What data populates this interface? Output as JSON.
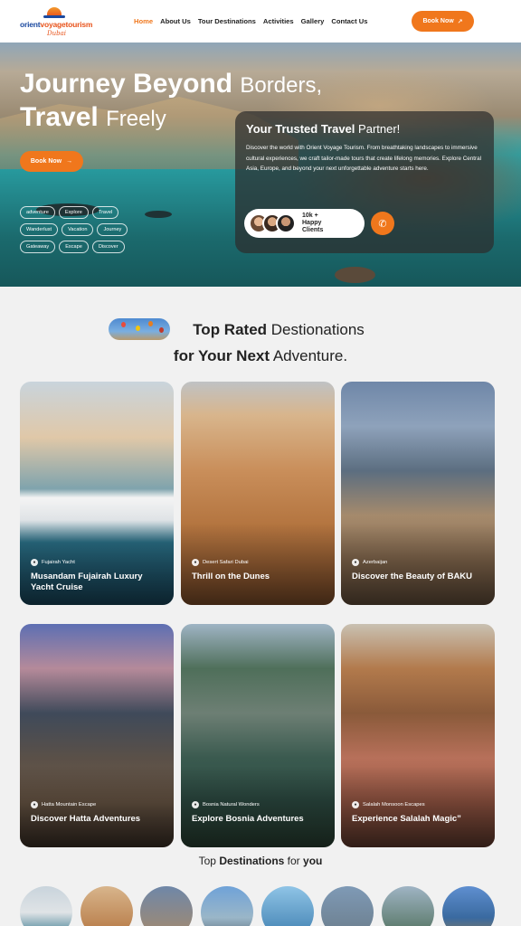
{
  "header": {
    "logo": {
      "name_part1": "orient",
      "name_part2": "voyagetourism",
      "sub": "Dubai"
    },
    "nav": [
      "Home",
      "About Us",
      "Tour Destinations",
      "Activities",
      "Gallery",
      "Contact Us"
    ],
    "active_nav": "Home",
    "book_label": "Book Now",
    "book_icon": "arrow-up-right-icon"
  },
  "hero": {
    "title_line1_bold": "Journey Beyond",
    "title_line1_thin": "Borders,",
    "title_line2_bold": "Travel",
    "title_line2_thin": "Freely",
    "book_label": "Book Now",
    "tags": [
      "adventure",
      "Explore",
      "Travel",
      "Wanderlust",
      "Vacation",
      "Journey",
      "Gateaway",
      "Escape",
      "Discover"
    ],
    "partner": {
      "title_bold": "Your Trusted Travel",
      "title_thin": "Partner!",
      "text": "Discover the world with Orient Voyage Tourism. From breathtaking landscapes to immersive cultural experiences, we craft tailor-made tours that create lifelong memories. Explore Central Asia, Europe, and beyond your next unforgettable adventure starts here.",
      "clients_line1": "10k +",
      "clients_line2": "Happy",
      "clients_line3": "Clients",
      "phone_icon": "phone-icon"
    }
  },
  "top_rated": {
    "line1_bold": "Top Rated",
    "line1_thin": "Destionations",
    "line2_bold": "for Your Next",
    "line2_thin": "Adventure."
  },
  "cards": [
    {
      "category": "Fujairah Yacht",
      "title": "Musandam Fujairah Luxury Yacht Cruise"
    },
    {
      "category": "Desert Safari Dubai",
      "title": "Thrill on the Dunes"
    },
    {
      "category": "Azerbaijan",
      "title": "Discover the Beauty of BAKU"
    },
    {
      "category": "Hatta Mountain Escape",
      "title": "Discover Hatta Adventures"
    },
    {
      "category": "Bosnia Natural Wonders",
      "title": "Explore Bosnia Adventures"
    },
    {
      "category": "Salalah Monsoon Escapes",
      "title": "Experience Salalah Magic”"
    }
  ],
  "top_destinations": {
    "pre": "Top",
    "bold": "Destinations",
    "mid": "for",
    "bold2": "you"
  },
  "colors": {
    "accent": "#f0771c",
    "brand_blue": "#1c4aa0"
  }
}
